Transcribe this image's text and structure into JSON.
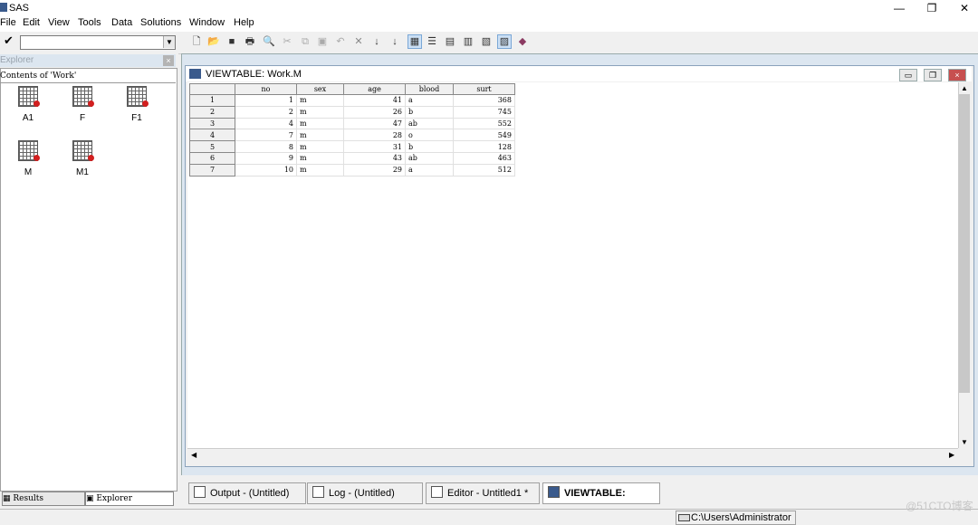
{
  "app": {
    "title": "SAS"
  },
  "window_controls": {
    "minimize": "—",
    "restore": "❐",
    "close": "✕"
  },
  "menu": [
    "File",
    "Edit",
    "View",
    "Tools",
    "Data",
    "Solutions",
    "Window",
    "Help"
  ],
  "toolbar": {
    "command_value": "",
    "icons": [
      "new-icon",
      "open-icon",
      "save-icon",
      "print-icon",
      "print-preview-icon",
      "cut-icon",
      "copy-icon",
      "paste-icon",
      "undo-icon",
      "clear-icon",
      "sort-asc-icon",
      "sort-desc-icon",
      "table-icon",
      "list-icon",
      "properties-icon",
      "explorer-icon",
      "results-icon",
      "options-icon",
      "help-book-icon"
    ]
  },
  "explorer": {
    "title": "Explorer",
    "contents_label": "Contents of 'Work'",
    "items": [
      "A1",
      "F",
      "F1",
      "M",
      "M1"
    ],
    "tabs": {
      "results": "Results",
      "explorer": "Explorer"
    }
  },
  "viewtable": {
    "title": "VIEWTABLE: Work.M",
    "columns": [
      "no",
      "sex",
      "age",
      "blood",
      "surt"
    ],
    "rows": [
      [
        "1",
        "1",
        "m",
        "41",
        "a",
        "368"
      ],
      [
        "2",
        "2",
        "m",
        "26",
        "b",
        "745"
      ],
      [
        "3",
        "4",
        "m",
        "47",
        "ab",
        "552"
      ],
      [
        "4",
        "7",
        "m",
        "28",
        "o",
        "549"
      ],
      [
        "5",
        "8",
        "m",
        "31",
        "b",
        "128"
      ],
      [
        "6",
        "9",
        "m",
        "43",
        "ab",
        "463"
      ],
      [
        "7",
        "10",
        "m",
        "29",
        "a",
        "512"
      ]
    ]
  },
  "task_tabs": [
    "Output - (Untitled)",
    "Log - (Untitled)",
    "Editor - Untitled1 *",
    "VIEWTABLE: Work.M"
  ],
  "status": {
    "path": "C:\\Users\\Administrator"
  },
  "watermark": "@51CTO博客"
}
